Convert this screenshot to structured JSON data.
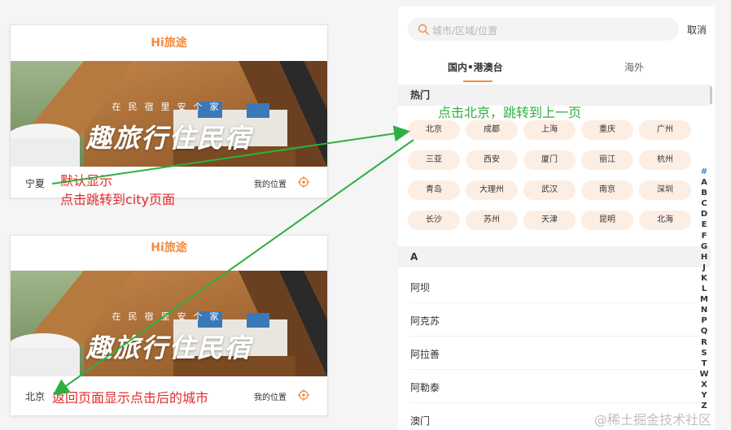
{
  "app": {
    "title": "Hi旅途"
  },
  "banner": {
    "slogan_small": "在民宿里安个家",
    "slogan_big": "趣旅行住民宿"
  },
  "card_default": {
    "city": "宁夏",
    "my_position": "我的位置"
  },
  "card_return": {
    "city": "北京",
    "my_position": "我的位置"
  },
  "annotations": {
    "default_show": "默认显示",
    "click_jump": "点击跳转到city页面",
    "click_beijing": "点击北京，跳转到上一页",
    "return_show": "返回页面显示点击后的城市"
  },
  "city_page": {
    "search_placeholder": "城市/区域/位置",
    "cancel_label": "取消",
    "tabs": [
      "国内•港澳台",
      "海外"
    ],
    "hot_header": "热门",
    "hot_cities": [
      "北京",
      "成都",
      "上海",
      "重庆",
      "广州",
      "三亚",
      "西安",
      "厦门",
      "丽江",
      "杭州",
      "青岛",
      "大理州",
      "武汉",
      "南京",
      "深圳",
      "长沙",
      "苏州",
      "天津",
      "昆明",
      "北海"
    ],
    "a_header": "A",
    "a_cities": [
      "阿坝",
      "阿克苏",
      "阿拉善",
      "阿勒泰",
      "澳门"
    ],
    "index_letters": [
      "#",
      "A",
      "B",
      "C",
      "D",
      "E",
      "F",
      "G",
      "H",
      "J",
      "K",
      "L",
      "M",
      "N",
      "P",
      "Q",
      "R",
      "S",
      "T",
      "W",
      "X",
      "Y",
      "Z"
    ]
  },
  "colors": {
    "brand": "#f38b3c",
    "chip_bg": "#fdeee4",
    "annotation_red": "#e32b2b",
    "annotation_green": "#2db040"
  },
  "watermark": "@稀土掘金技术社区"
}
